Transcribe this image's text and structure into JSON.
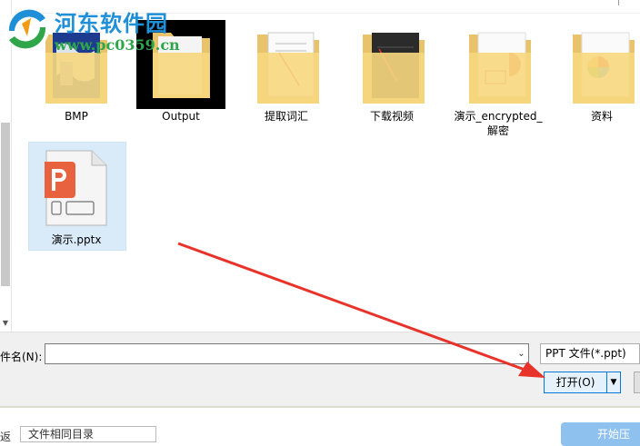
{
  "watermark": {
    "title": "河东软件园",
    "url": "www.pc0359.cn"
  },
  "files": [
    {
      "name": "BMP",
      "type": "folder"
    },
    {
      "name": "Output",
      "type": "folder"
    },
    {
      "name": "提取词汇",
      "type": "folder"
    },
    {
      "name": "下载视频",
      "type": "folder"
    },
    {
      "name": "演示_encrypted_解密",
      "label_line1": "演示_encrypted_",
      "label_line2": "解密",
      "type": "folder"
    },
    {
      "name": "资料",
      "type": "folder"
    },
    {
      "name": "演示.pptx",
      "type": "pptx",
      "selected": true
    }
  ],
  "dialog": {
    "filename_label": "件名(N):",
    "filename_value": "",
    "filetype": "PPT 文件(*.ppt)",
    "open_label": "打开(O)"
  },
  "lower": {
    "label": "返",
    "input_value": "文件相同目录",
    "start_label": "开始压"
  },
  "colors": {
    "accent": "#0078d7",
    "selection": "#d9ebf9",
    "annotation_arrow": "#e8332a",
    "ppt_orange": "#e8623f"
  }
}
